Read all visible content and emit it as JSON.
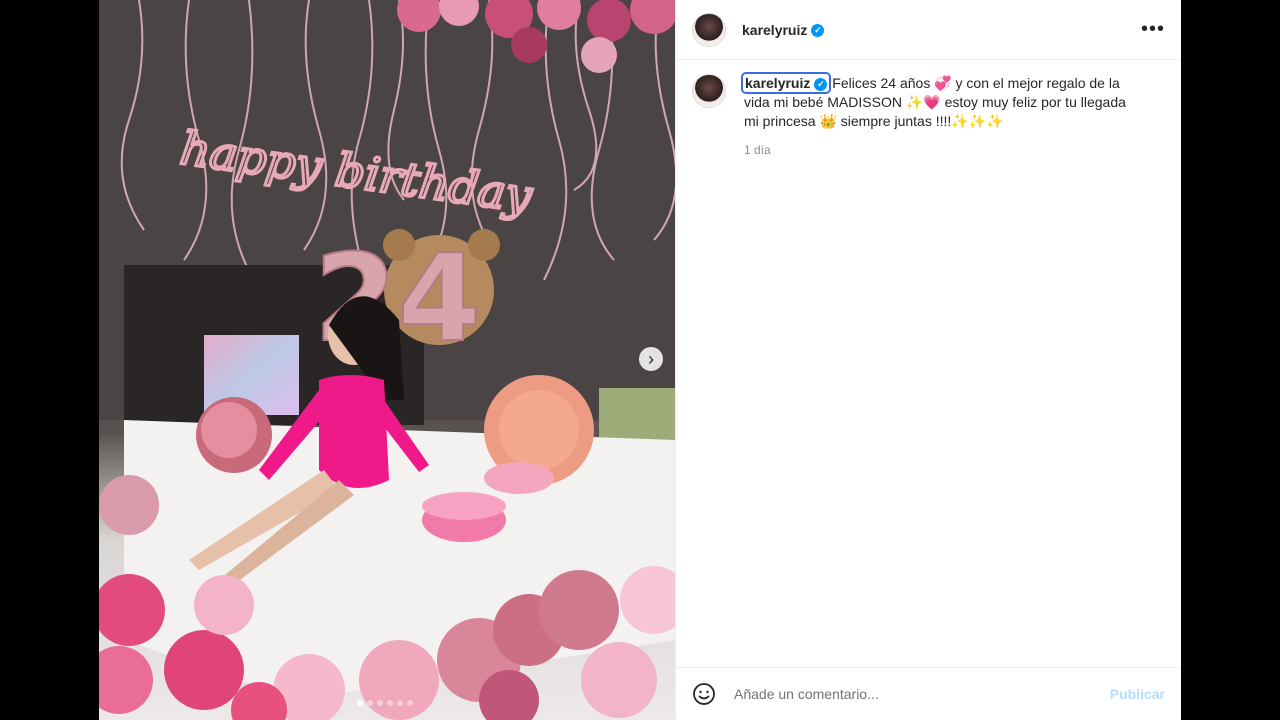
{
  "post": {
    "username": "karelyruiz",
    "verified_mark": "✓",
    "more_icon": "•••",
    "next_icon": "›",
    "image_text": "happy birthday",
    "age_number": "24",
    "carousel": {
      "count": 6,
      "active": 0
    }
  },
  "caption": {
    "username": "karelyruiz",
    "text": "Felices 24 años 💞 y con el mejor regalo de la vida mi bebé MADISSON ✨💗 estoy muy feliz por tu llegada mi princesa 👑 siempre juntas !!!!✨✨✨",
    "time": "1 día"
  },
  "comment_box": {
    "placeholder": "Añade un comentario...",
    "publish_label": "Publicar"
  },
  "colors": {
    "verified": "#0095f6",
    "publish_disabled": "#b2dffc",
    "dress": "#f0198a",
    "balloon_pink": "#ec5a8a",
    "balloon_rose": "#d9859a"
  }
}
